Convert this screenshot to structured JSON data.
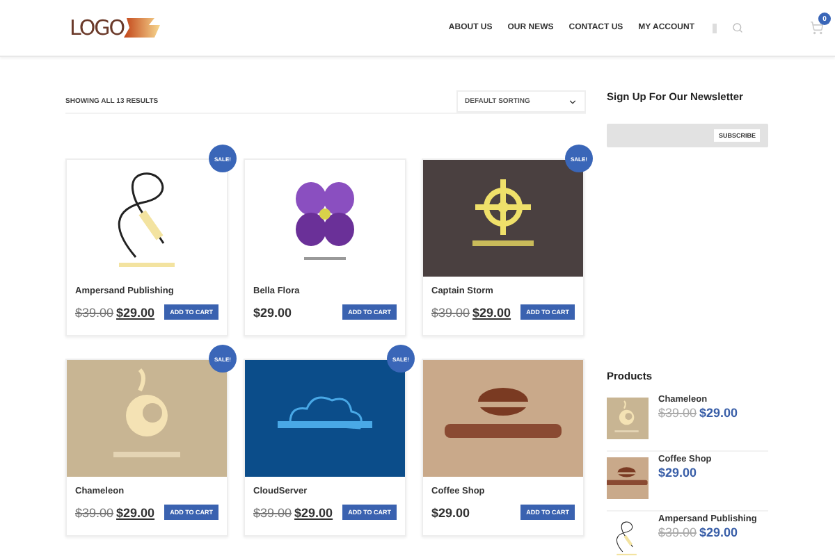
{
  "header": {
    "logo": "LOGO",
    "nav": [
      {
        "label": "ABOUT US"
      },
      {
        "label": "OUR NEWS"
      },
      {
        "label": "CONTACT US"
      },
      {
        "label": "MY ACCOUNT"
      }
    ],
    "cart_count": "0"
  },
  "shop": {
    "results": "SHOWING ALL 13 RESULTS",
    "sorting": "DEFAULT SORTING",
    "products": [
      {
        "name": "Ampersand Publishing",
        "old_price": "$39.00",
        "price": "$29.00",
        "sale": true,
        "sale_label": "SALE!",
        "button": "ADD TO CART"
      },
      {
        "name": "Bella Flora",
        "price": "$29.00",
        "sale": false,
        "button": "ADD TO CART"
      },
      {
        "name": "Captain Storm",
        "old_price": "$39.00",
        "price": "$29.00",
        "sale": true,
        "sale_label": "SALE!",
        "button": "ADD TO CART"
      },
      {
        "name": "Chameleon",
        "old_price": "$39.00",
        "price": "$29.00",
        "sale": true,
        "sale_label": "SALE!",
        "button": "ADD TO CART"
      },
      {
        "name": "CloudServer",
        "old_price": "$39.00",
        "price": "$29.00",
        "sale": true,
        "sale_label": "SALE!",
        "button": "ADD TO CART"
      },
      {
        "name": "Coffee Shop",
        "price": "$29.00",
        "sale": false,
        "button": "ADD TO CART"
      }
    ]
  },
  "sidebar": {
    "newsletter": {
      "title": "Sign Up For Our Newsletter",
      "button": "SUBSCRIBE"
    },
    "products": {
      "title": "Products",
      "items": [
        {
          "name": "Chameleon",
          "old_price": "$39.00",
          "price": "$29.00"
        },
        {
          "name": "Coffee Shop",
          "price": "$29.00"
        },
        {
          "name": "Ampersand Publishing",
          "old_price": "$39.00",
          "price": "$29.00"
        }
      ]
    }
  }
}
